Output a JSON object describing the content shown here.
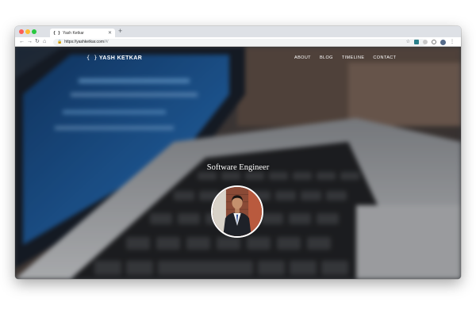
{
  "browser": {
    "tab": {
      "favicon": "{ }",
      "title": "Yash Ketkar",
      "close_icon": "close-icon"
    },
    "new_tab_symbol": "+",
    "url": {
      "host": "https://yashketkar.com",
      "path": "/#/"
    }
  },
  "site": {
    "brand_mark": "{ }",
    "brand_name": "YASH KETKAR",
    "nav": [
      "ABOUT",
      "BLOG",
      "TIMELINE",
      "CONTACT"
    ],
    "headline": "Software Engineer",
    "background_image": "blurred laptop keyboard photo",
    "profile_image": "portrait photo of a man in a suit"
  },
  "colors": {
    "close": "#fe5f57",
    "minimize": "#febc2e",
    "zoom": "#28c840",
    "text_on_hero": "#ffffff"
  }
}
